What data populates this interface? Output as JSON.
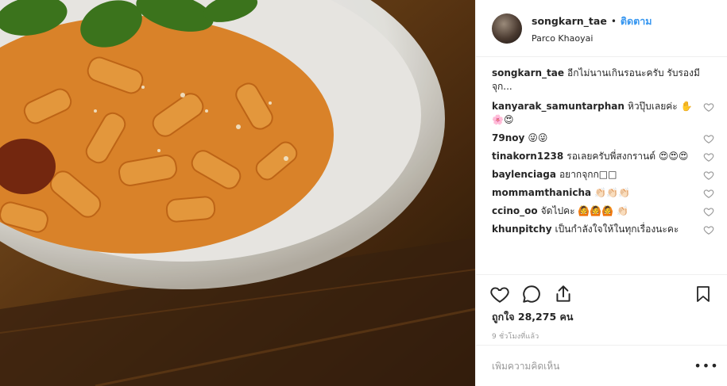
{
  "post": {
    "username": "songkarn_tae",
    "follow_label": "ติดตาม",
    "location": "Parco Khaoyai",
    "caption_user": "songkarn_tae",
    "caption_text": "อีกไม่นานเกินรอนะครับ รับรองมีจุก..."
  },
  "comments": [
    {
      "user": "kanyarak_samuntarphan",
      "text": "หิวปุ๊บเลยค่ะ ✋🌸😍"
    },
    {
      "user": "79noy",
      "text": "😜😜"
    },
    {
      "user": "tinakorn1238",
      "text": "รอเลยครับพี่สงกรานต์ 😍😍😍"
    },
    {
      "user": "baylenciaga",
      "text": "อยากจุกก□□"
    },
    {
      "user": "mommamthanicha",
      "text": "👏🏻👏🏻👏🏻"
    },
    {
      "user": "ccino_oo",
      "text": "จัดไปคะ 🙆🙆🙆 👏🏻"
    },
    {
      "user": "khunpitchy",
      "text": "เป็นกำลังใจให้ในทุกเรื่องนะคะ"
    }
  ],
  "likes_text": "ถูกใจ 28,275 คน",
  "time_text": "9 ชั่วโมงที่แล้ว",
  "add_comment_placeholder": "เพิ่มความคิดเห็น",
  "icons": {
    "like": "heart-icon",
    "comment": "comment-icon",
    "share": "share-icon",
    "save": "bookmark-icon",
    "more": "more-options-icon"
  },
  "colors": {
    "follow": "#3897f0",
    "text": "#262626",
    "muted": "#999999"
  }
}
